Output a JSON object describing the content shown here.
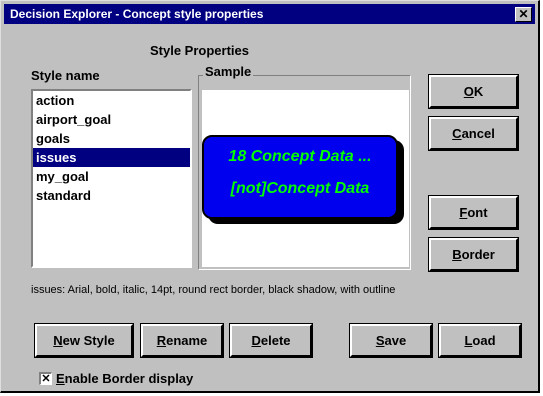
{
  "window": {
    "title": "Decision Explorer - Concept style properties",
    "close_glyph": "✕"
  },
  "labels": {
    "style_properties": "Style Properties",
    "style_name": "Style name",
    "sample": "Sample"
  },
  "styles": {
    "items": [
      "action",
      "airport_goal",
      "goals",
      "issues",
      "my_goal",
      "standard"
    ],
    "selected": "issues"
  },
  "sample": {
    "line1": "18 Concept Data ...",
    "line2": "[not]Concept Data"
  },
  "description": "issues: Arial, bold, italic, 14pt, round rect border, black shadow, with outline",
  "buttons": {
    "ok": {
      "mn": "O",
      "rest": "K"
    },
    "cancel": {
      "mn": "C",
      "rest": "ancel"
    },
    "font": {
      "mn": "F",
      "rest": "ont"
    },
    "border": {
      "mn": "B",
      "rest": "order"
    },
    "new_style": {
      "mn": "N",
      "rest": "ew Style"
    },
    "rename": {
      "mn": "R",
      "rest": "ename"
    },
    "delete": {
      "mn": "D",
      "rest": "elete"
    },
    "save": {
      "mn": "S",
      "rest": "ave"
    },
    "load": {
      "mn": "L",
      "rest": "oad"
    }
  },
  "enable_border": {
    "checked": true,
    "mark": "✕",
    "mn": "E",
    "rest": "nable Border display"
  },
  "colors": {
    "title_bar": "#000080",
    "concept_fill": "#0000ee",
    "concept_text": "#00ff00",
    "selection": "#000080"
  }
}
